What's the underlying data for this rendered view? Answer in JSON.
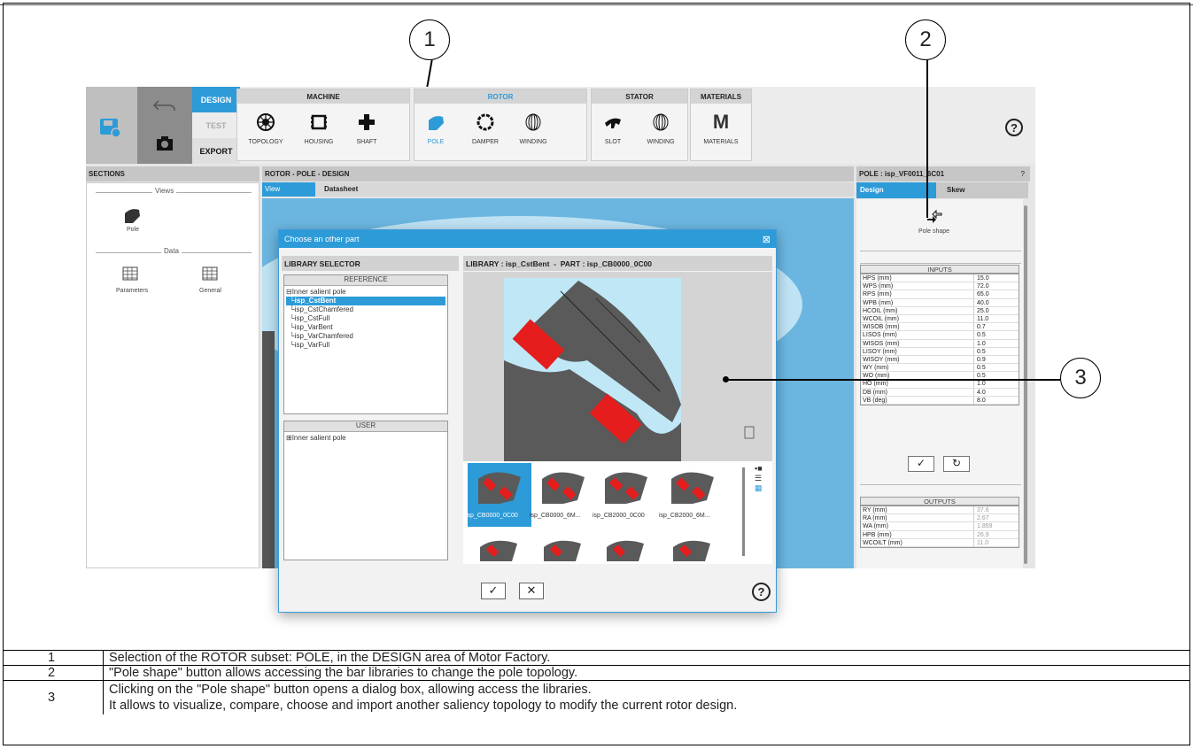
{
  "toolbar": {
    "modes": [
      "DESIGN",
      "TEST",
      "EXPORT"
    ],
    "groups": [
      {
        "title": "MACHINE",
        "buttons": [
          "TOPOLOGY",
          "HOUSING",
          "SHAFT"
        ]
      },
      {
        "title": "ROTOR",
        "buttons": [
          "POLE",
          "DAMPER",
          "WINDING"
        ]
      },
      {
        "title": "STATOR",
        "buttons": [
          "SLOT",
          "WINDING"
        ]
      },
      {
        "title": "MATERIALS",
        "buttons": [
          "MATERIALS"
        ]
      }
    ],
    "help": "?"
  },
  "sections": {
    "title": "SECTIONS",
    "views_label": "Views",
    "pole_label": "Pole",
    "data_label": "Data",
    "parameters_label": "Parameters",
    "general_label": "General"
  },
  "center": {
    "title": "ROTOR - POLE - DESIGN",
    "tabs": [
      "View",
      "Datasheet"
    ]
  },
  "right": {
    "title": "POLE : isp_VF0011_6C01",
    "help": "?",
    "tabs": [
      "Design",
      "Skew"
    ],
    "pole_shape_label": "Pole shape",
    "inputs_title": "INPUTS",
    "inputs": [
      [
        "HPS (mm)",
        "15.0"
      ],
      [
        "WPS (mm)",
        "72.0"
      ],
      [
        "RPS (mm)",
        "65.0"
      ],
      [
        "WPB (mm)",
        "40.0"
      ],
      [
        "HCOIL (mm)",
        "25.0"
      ],
      [
        "WCOIL (mm)",
        "11.0"
      ],
      [
        "WISOB (mm)",
        "0.7"
      ],
      [
        "LISOS (mm)",
        "0.5"
      ],
      [
        "WISOS (mm)",
        "1.0"
      ],
      [
        "LISOY (mm)",
        "0.5"
      ],
      [
        "WISOY (mm)",
        "0.9"
      ],
      [
        "WY (mm)",
        "0.5"
      ],
      [
        "WO (mm)",
        "0.5"
      ],
      [
        "HO (mm)",
        "1.0"
      ],
      [
        "DB (mm)",
        "4.0"
      ],
      [
        "VB (deg)",
        "8.0"
      ]
    ],
    "outputs_title": "OUTPUTS",
    "outputs": [
      [
        "RY (mm)",
        "37.6"
      ],
      [
        "RA (mm)",
        "2.67"
      ],
      [
        "WA (mm)",
        "1.859"
      ],
      [
        "HPB (mm)",
        "26.9"
      ],
      [
        "WCOILT (mm)",
        "11.0"
      ]
    ]
  },
  "dialog": {
    "title": "Choose an other part",
    "close": "⊠",
    "library_selector": "LIBRARY SELECTOR",
    "reference": "REFERENCE",
    "ref_root": "Inner salient pole",
    "ref_items": [
      "isp_CstBent",
      "isp_CstChamfered",
      "isp_CstFull",
      "isp_VarBent",
      "isp_VarChamfered",
      "isp_VarFull"
    ],
    "user": "USER",
    "user_root": "Inner salient pole",
    "library_header": "LIBRARY : isp_CstBent  -  PART : isp_CB0000_0C00",
    "thumbs": [
      "isp_CB0000_0C00",
      "isp_CB0000_6M...",
      "isp_CB2000_0C00",
      "isp_CB2000_6M..."
    ],
    "help": "?"
  },
  "callouts": [
    "1",
    "2",
    "3"
  ],
  "legend": [
    {
      "num": "1",
      "text": "Selection of the ROTOR subset: POLE, in the DESIGN area of Motor Factory."
    },
    {
      "num": "2",
      "text": "\"Pole shape\" button allows accessing the bar libraries to change the pole topology."
    },
    {
      "num": "3",
      "line1": "Clicking on the \"Pole shape\" button opens a dialog box, allowing access the libraries.",
      "line2": "It allows to visualize, compare, choose and import another saliency topology to modify the current rotor design."
    }
  ],
  "colors": {
    "accent": "#2d9bd8",
    "pole_grey": "#5a5a5a",
    "magnet_red": "#e51d1d",
    "light_blue": "#bfe7f5"
  }
}
